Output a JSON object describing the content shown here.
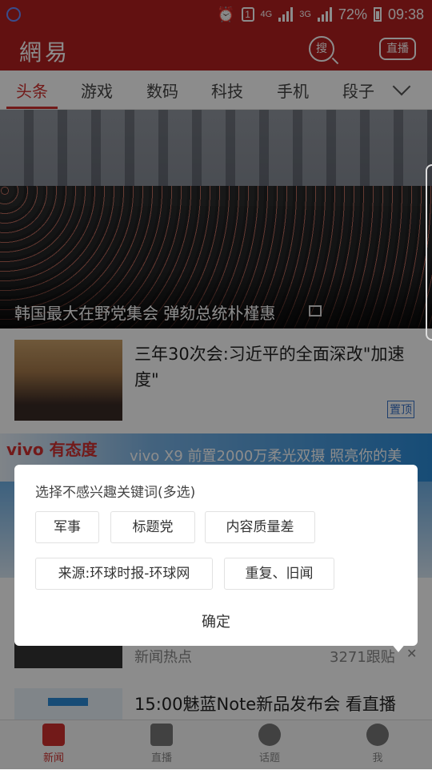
{
  "status_bar": {
    "battery": "72%",
    "time": "09:38",
    "sim_badge": "1",
    "net_4g": "4G",
    "net_3g": "3G"
  },
  "app_bar": {
    "logo": "網易",
    "search_label": "搜",
    "live_label": "直播"
  },
  "tabs": [
    "头条",
    "游戏",
    "数码",
    "科技",
    "手机",
    "段子"
  ],
  "hero": {
    "title": "韩国最大在野党集会 弹劾总统朴槿惠"
  },
  "news": [
    {
      "title": "三年30次会:习近平的全面深改\"加速度\"",
      "badge": "置顶"
    },
    {
      "meta": "新闻热点",
      "count": "3271跟贴"
    },
    {
      "title": "15:00魅蓝Note新品发布会 看直播"
    }
  ],
  "ad": {
    "left_text": "vivo 有态度",
    "text": "vivo X9  前置2000万柔光双摄 照亮你的美"
  },
  "dialog": {
    "title": "选择不感兴趣关键词(多选)",
    "keywords": [
      "军事",
      "标题党",
      "内容质量差",
      "来源:环球时报-环球网",
      "重复、旧闻"
    ],
    "confirm": "确定"
  },
  "bottom_nav": [
    "新闻",
    "直播",
    "话题",
    "我"
  ],
  "colors": {
    "brand_red": "#b21f1f",
    "accent_red": "#d0302f",
    "pin_blue": "#3a73c8"
  }
}
